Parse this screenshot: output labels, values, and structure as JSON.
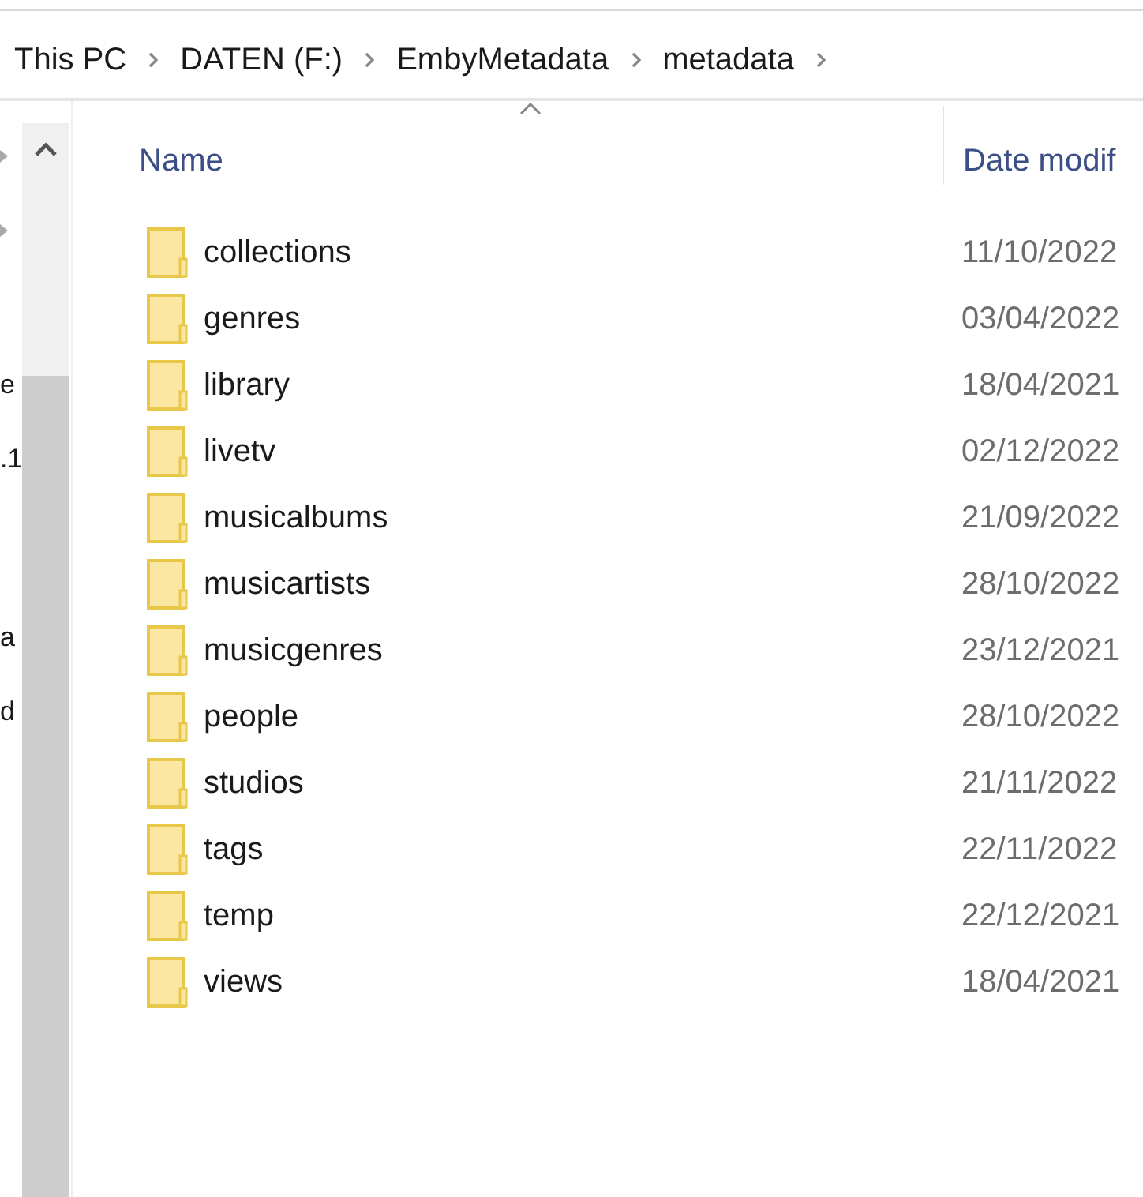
{
  "breadcrumb": [
    "This PC",
    "DATEN (F:)",
    "EmbyMetadata",
    "metadata"
  ],
  "nav_pane": {
    "items": [
      {
        "label": "e"
      },
      {
        "label": ".1"
      },
      {
        "label": "a"
      },
      {
        "label": "d"
      }
    ]
  },
  "columns": [
    {
      "label": "Name",
      "sorted": true
    },
    {
      "label": "Date modif",
      "sorted": false
    }
  ],
  "rows": [
    {
      "name": "collections",
      "date": "11/10/2022"
    },
    {
      "name": "genres",
      "date": "03/04/2022"
    },
    {
      "name": "library",
      "date": "18/04/2021"
    },
    {
      "name": "livetv",
      "date": "02/12/2022"
    },
    {
      "name": "musicalbums",
      "date": "21/09/2022"
    },
    {
      "name": "musicartists",
      "date": "28/10/2022"
    },
    {
      "name": "musicgenres",
      "date": "23/12/2021"
    },
    {
      "name": "people",
      "date": "28/10/2022"
    },
    {
      "name": "studios",
      "date": "21/11/2022"
    },
    {
      "name": "tags",
      "date": "22/11/2022"
    },
    {
      "name": "temp",
      "date": "22/12/2021"
    },
    {
      "name": "views",
      "date": "18/04/2021"
    }
  ]
}
